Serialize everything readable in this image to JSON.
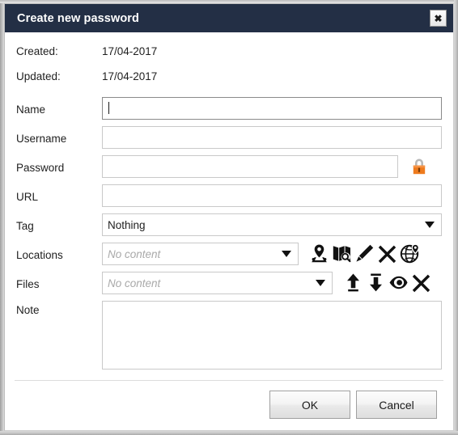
{
  "window": {
    "title": "Create new password",
    "close_label": "✖",
    "titlebar_color": "#232f45"
  },
  "meta": [
    {
      "label": "Created:",
      "value": "17/04-2017"
    },
    {
      "label": "Updated:",
      "value": "17/04-2017"
    }
  ],
  "fields": {
    "name": {
      "label": "Name",
      "value": "",
      "focused": true
    },
    "username": {
      "label": "Username",
      "value": ""
    },
    "password": {
      "label": "Password",
      "value": "",
      "generate_icon": "padlock-icon"
    },
    "url": {
      "label": "URL",
      "value": ""
    },
    "tag": {
      "label": "Tag",
      "value": "Nothing",
      "enabled": true
    },
    "locations": {
      "label": "Locations",
      "value": "No content",
      "enabled": false
    },
    "files": {
      "label": "Files",
      "value": "No content",
      "enabled": false
    },
    "note": {
      "label": "Note",
      "value": ""
    }
  },
  "location_actions": [
    {
      "name": "add-location-icon",
      "title": "Add location"
    },
    {
      "name": "search-map-icon",
      "title": "Search map"
    },
    {
      "name": "edit-pencil-icon",
      "title": "Edit"
    },
    {
      "name": "delete-x-icon",
      "title": "Delete"
    },
    {
      "name": "globe-location-icon",
      "title": "Show on globe"
    }
  ],
  "file_actions": [
    {
      "name": "upload-arrow-icon",
      "title": "Upload"
    },
    {
      "name": "download-arrow-icon",
      "title": "Download"
    },
    {
      "name": "view-eye-icon",
      "title": "View"
    },
    {
      "name": "delete-x-icon",
      "title": "Delete"
    }
  ],
  "footer": {
    "ok_label": "OK",
    "cancel_label": "Cancel"
  },
  "colors": {
    "accent_orange": "#ee7b1e",
    "titlebar": "#232f45",
    "border": "#c9c9c9"
  }
}
